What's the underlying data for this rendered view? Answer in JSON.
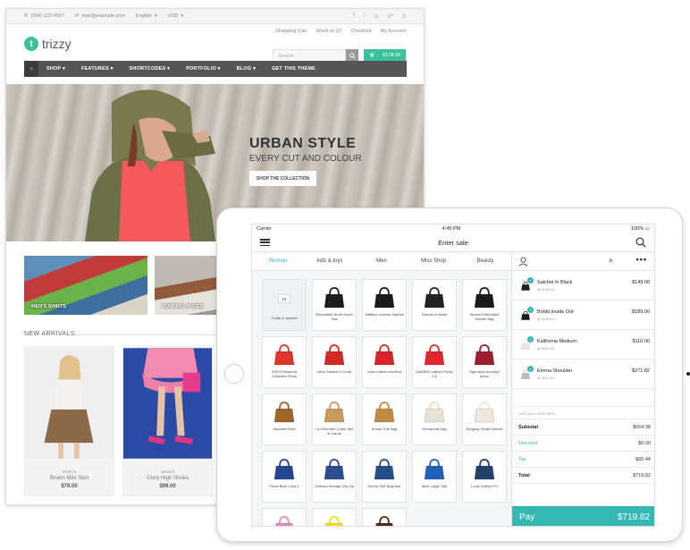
{
  "website": {
    "topbar": {
      "phone": "(564) 123 4567",
      "email": "mail@example.com",
      "language": "English",
      "currency": "USD"
    },
    "brand": {
      "name": "trizzy"
    },
    "account_links": [
      "Shopping Cart",
      "WishList (2)",
      "Checkout",
      "My Account"
    ],
    "search": {
      "placeholder": "Search"
    },
    "cart": {
      "total": "$178.00"
    },
    "nav": [
      "SHOP",
      "FEATURES",
      "SHORTCODES",
      "PORTFOLIO",
      "BLOG",
      "GET THIS THEME"
    ],
    "hero": {
      "title": "URBAN STYLE",
      "subtitle": "EVERY CUT AND COLOUR",
      "cta": "SHOP THE COLLECTION"
    },
    "categories": [
      "MEN'S SHIRTS",
      "RUNNING SHOES"
    ],
    "new_arrivals_label": "NEW ARRIVALS",
    "products": [
      {
        "category": "SKIRTS",
        "name": "Brown Mini Skirt",
        "price": "$79.00"
      },
      {
        "category": "SHOES",
        "name": "Glory High Shoes",
        "price": "$99.00"
      }
    ]
  },
  "pos": {
    "status": {
      "carrier": "Carrier",
      "time": "4:45 PM",
      "battery": "100%"
    },
    "title": "Enter sale",
    "tabs": [
      "Women",
      "kids & toys",
      "Men",
      "Miss Shop",
      "Beauty"
    ],
    "active_tab": "Women",
    "tiles": [
      {
        "name": "Coats & Jackets",
        "badge": "21",
        "color": "#ffffff"
      },
      {
        "name": "Reversible North South Tote",
        "color": "#1d1d1d"
      },
      {
        "name": "Saffiano Leather Satchel",
        "color": "#1a1a1a"
      },
      {
        "name": "Satchel In Black",
        "color": "#222222"
      },
      {
        "name": "Woven Embossed Handle Bag",
        "color": "#1b1b1b"
      },
      {
        "name": "FERI Primavera Collection Rose",
        "color": "#e0352b"
      },
      {
        "name": "Irene Satchel in Coral",
        "color": "#d42a25"
      },
      {
        "name": "Louis vuitton neverfull",
        "color": "#d8242a"
      },
      {
        "name": "DANIER Leather Purse 1.5",
        "color": "#e0262e"
      },
      {
        "name": "Oglo wine brooklyn purse",
        "color": "#9b1f2c"
      },
      {
        "name": "Studded Hobo",
        "color": "#a0632c"
      },
      {
        "name": "Liz Grommet Chain Tote in Camel",
        "color": "#c79a5d"
      },
      {
        "name": "Emma Tote Bag",
        "color": "#c08a45"
      },
      {
        "name": "Emma tote bag",
        "color": "#e8e1d6"
      },
      {
        "name": "Kingsley Small Satchel",
        "color": "#efe7da"
      },
      {
        "name": "Purse Blue Coral 2",
        "color": "#23478f"
      },
      {
        "name": "Chelsea Vintage City Zip",
        "color": "#2d4e8c"
      },
      {
        "name": "Emma Tote Bag blue",
        "color": "#254f86"
      },
      {
        "name": "Alice Large Tote",
        "color": "#1f63b8"
      },
      {
        "name": "Louis Vuitton PH",
        "color": "#23406b"
      },
      {
        "name": "",
        "color": "#e48bb6"
      },
      {
        "name": "",
        "color": "#f0e021"
      },
      {
        "name": "",
        "color": "#4a2a1c"
      }
    ],
    "cart_items": [
      {
        "qty": "1",
        "name": "Satchel In Black",
        "each": "@ $149.00",
        "price": "$149.00",
        "color": "#222222"
      },
      {
        "qty": "1",
        "name": "Bobbi Inside Out",
        "each": "@ $189.00",
        "price": "$189.00",
        "color": "#1d1d1d"
      },
      {
        "qty": "1",
        "name": "Kalifornia Medium",
        "each": "@ $110.00",
        "price": "$110.00",
        "color": "#ece7df"
      },
      {
        "qty": "1",
        "name": "Emma Shoulder",
        "each": "@ $271.82",
        "price": "$271.82",
        "color": "#bfbdbb"
      }
    ],
    "notes_placeholder": "Add your notes here...",
    "totals": {
      "subtotal_label": "Subtotal",
      "subtotal": "$654.38",
      "discount_label": "Discount",
      "discount": "$0.00",
      "tax_label": "Tax",
      "tax": "$65.44",
      "total_label": "Total",
      "total": "$719.82"
    },
    "pay": {
      "label": "Pay",
      "amount": "$719.82"
    }
  },
  "colors": {
    "accent_green": "#3cc29a",
    "accent_teal": "#35b8b1",
    "nav_dark": "#555555"
  }
}
